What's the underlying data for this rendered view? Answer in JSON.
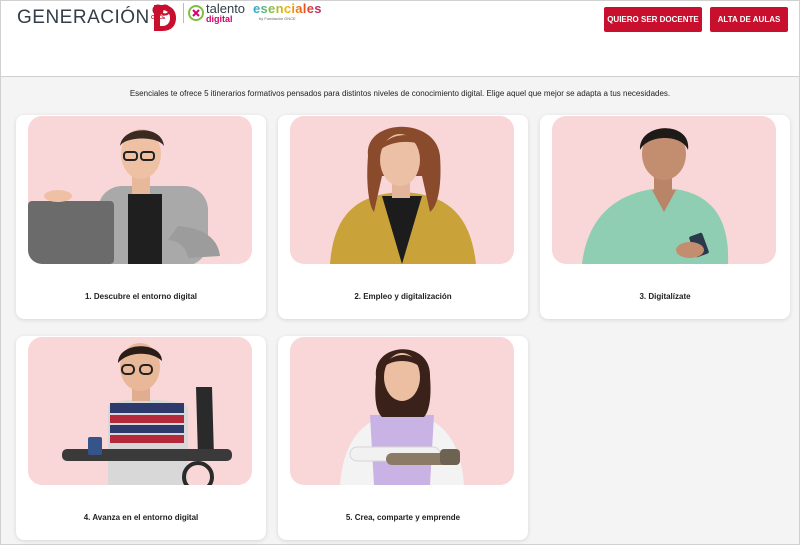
{
  "header": {
    "brand": "GENERACIÓN",
    "once_label": "ONCE",
    "talento_word": "talento",
    "talento_sub": "digital",
    "esenciales_word": "esenciales",
    "esenciales_sub": "by Fundación ONCE",
    "btn_docente": "QUIERO SER DOCENTE",
    "btn_aulas": "ALTA DE AULAS",
    "accent_color": "#c8102e"
  },
  "intro": "Esenciales te ofrece 5 itinerarios formativos pensados para distintos niveles de conocimiento digital. Elige aquel que mejor se adapta a tus necesidades.",
  "cards": [
    {
      "label": "1. Descubre el entorno digital",
      "image": "man-with-laptop"
    },
    {
      "label": "2. Empleo y digitalización",
      "image": "woman-in-yellow-jacket"
    },
    {
      "label": "3. Digitalízate",
      "image": "woman-with-phone"
    },
    {
      "label": "4. Avanza en el entorno digital",
      "image": "man-in-wheelchair"
    },
    {
      "label": "5. Crea, comparte y emprende",
      "image": "woman-with-prosthetic-arm"
    }
  ]
}
